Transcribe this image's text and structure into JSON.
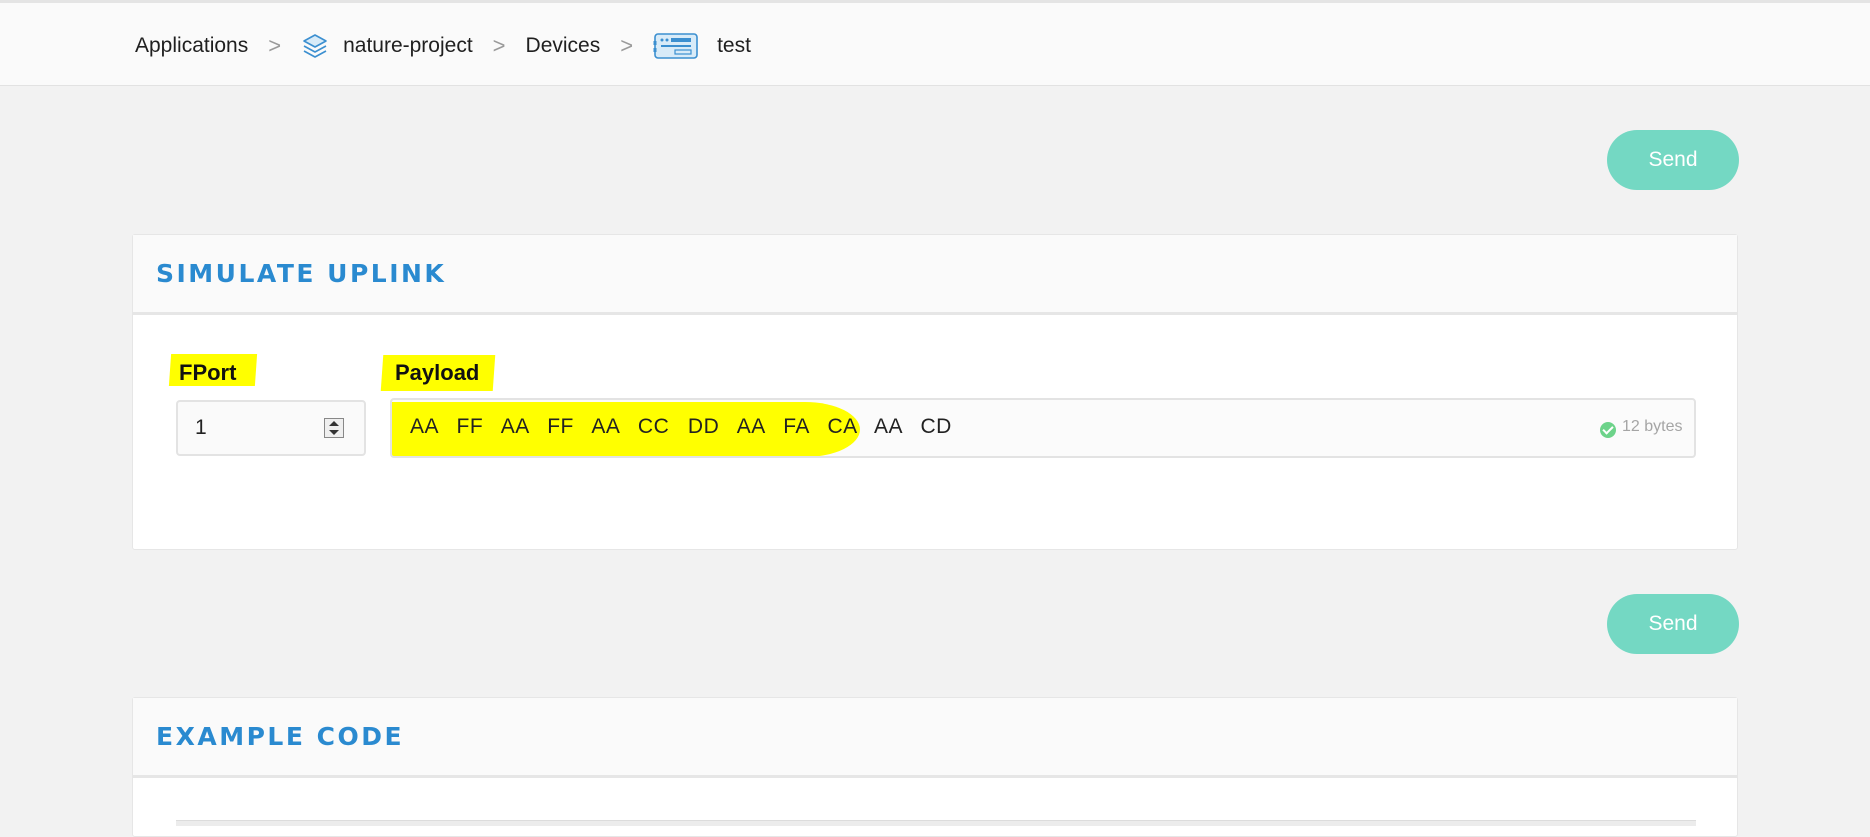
{
  "breadcrumb": {
    "applications": "Applications",
    "project": "nature-project",
    "devices": "Devices",
    "device": "test",
    "separator": ">"
  },
  "buttons": {
    "send_top": "Send",
    "send_bottom": "Send"
  },
  "simulate_uplink": {
    "title": "SIMULATE UPLINK",
    "fport_label": "FPort",
    "fport_value": "1",
    "payload_label": "Payload",
    "payload_value": "AA  FF  AA  FF  AA  CC  DD  AA  FA  CA  AA  CD",
    "byte_count": "12 bytes"
  },
  "example_code": {
    "title": "EXAMPLE CODE"
  },
  "colors": {
    "accent_teal": "#74d8c3",
    "title_blue": "#2a8ad0",
    "highlight": "#ffff00",
    "valid_green": "#6dd38a"
  },
  "icons": [
    "layers-icon",
    "device-icon",
    "chevron-right-icon",
    "check-icon",
    "stepper-icon"
  ]
}
